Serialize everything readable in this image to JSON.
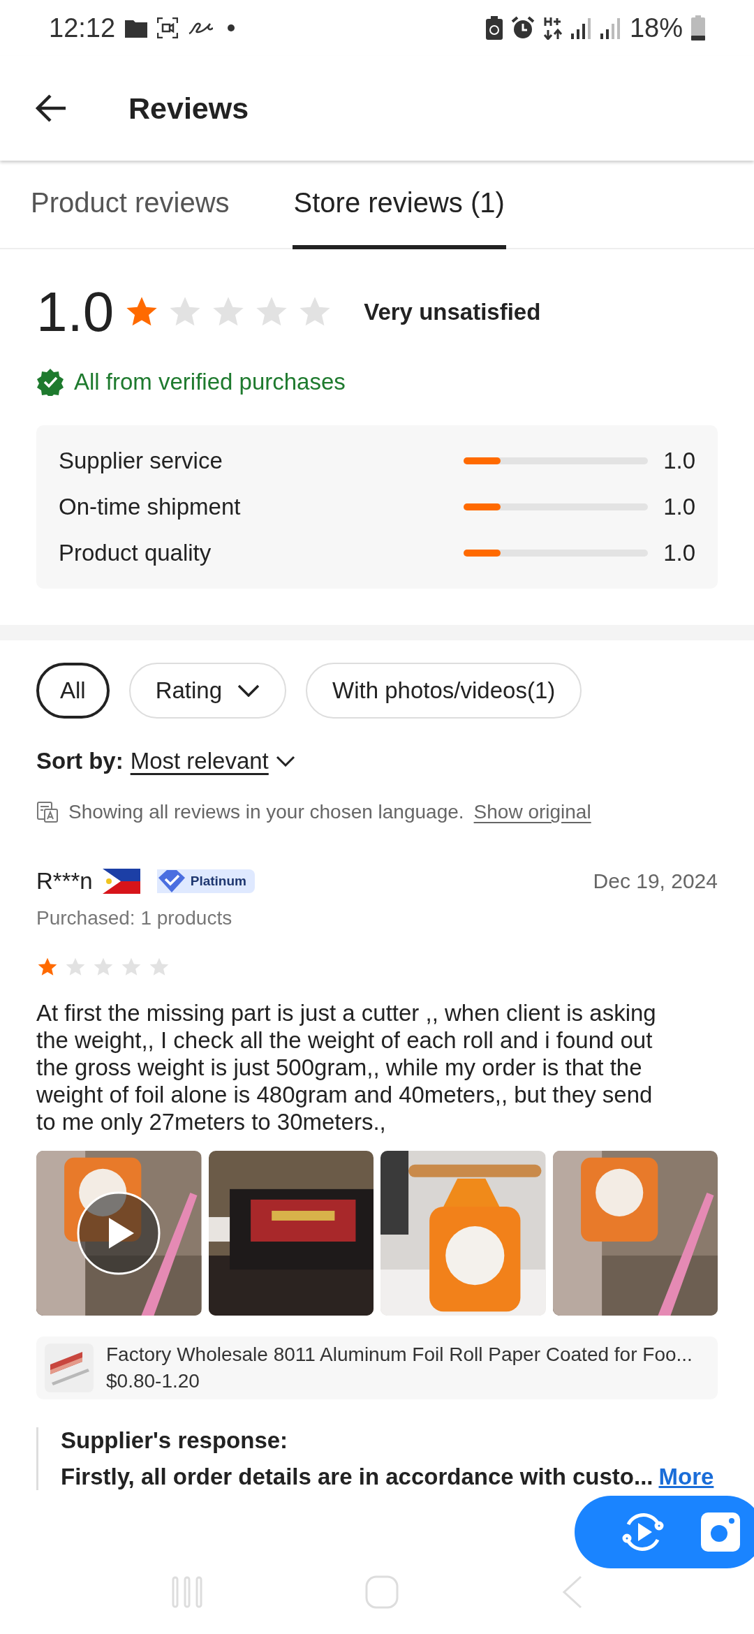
{
  "status_bar": {
    "time": "12:12",
    "battery": "18%"
  },
  "header": {
    "title": "Reviews"
  },
  "tabs": [
    {
      "label": "Product reviews",
      "selected": false
    },
    {
      "label": "Store reviews (1)",
      "selected": true
    }
  ],
  "summary": {
    "score": "1.0",
    "stars": 1,
    "label": "Very unsatisfied",
    "verified": "All from verified purchases",
    "metrics": [
      {
        "label": "Supplier service",
        "level": 0.2,
        "value": "1.0"
      },
      {
        "label": "On-time shipment",
        "level": 0.2,
        "value": "1.0"
      },
      {
        "label": "Product quality",
        "level": 0.2,
        "value": "1.0"
      }
    ]
  },
  "filters": [
    {
      "label": "All",
      "kind": "plain",
      "selected": true
    },
    {
      "label": "Rating",
      "kind": "dropdown",
      "selected": false
    },
    {
      "label": "With photos/videos(1)",
      "kind": "plain",
      "selected": false
    }
  ],
  "sort": {
    "label": "Sort by:",
    "value": "Most relevant"
  },
  "translation": {
    "text": "Showing all reviews in your chosen language.",
    "link": "Show original"
  },
  "review": {
    "author": "R***n",
    "badge": "Platinum",
    "date": "Dec 19, 2024",
    "purchased": "Purchased: 1 products",
    "stars": 1,
    "text": "At first the missing part is just a cutter ,, when client is asking the weight,, I check all the  weight of each roll and i found out the  gross weight is just 500gram,, while my order is that the weight of foil alone is 480gram and 40meters,, but they send to me only 27meters to 30meters.,",
    "media": [
      {
        "kind": "video"
      },
      {
        "kind": "picture"
      },
      {
        "kind": "picture"
      },
      {
        "kind": "picture"
      }
    ],
    "product": {
      "title": "Factory Wholesale 8011 Aluminum Foil Roll Paper Coated for Foo...",
      "price": "$0.80-1.20"
    },
    "response": {
      "heading": "Supplier's response:",
      "text": "Firstly, all order details are in accordance with custo...",
      "more": "More"
    }
  }
}
